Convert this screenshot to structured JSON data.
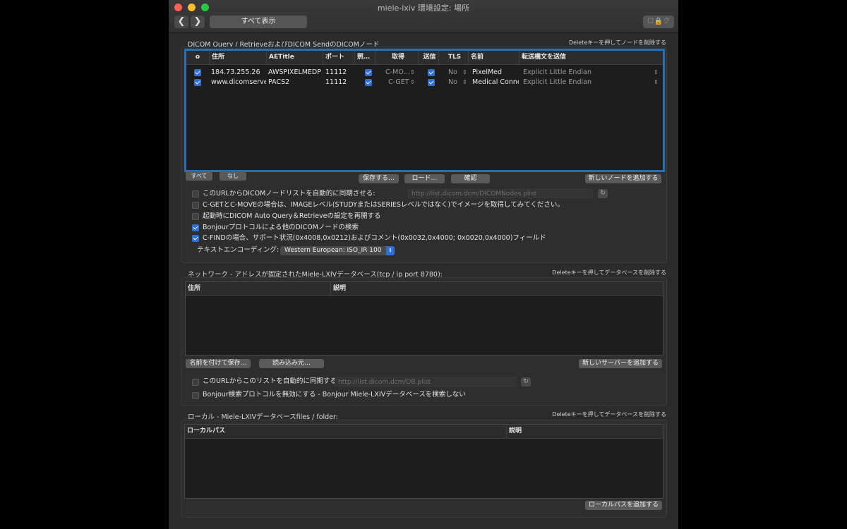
{
  "window": {
    "title": "miele-lxiv 環境設定: 場所"
  },
  "toolbar": {
    "back": "❮",
    "forward": "❯",
    "show_all": "すべて表示",
    "lock": "ロ🔒ク"
  },
  "dicom": {
    "title": "DICOM Query / RetrieveおよびDICOM SendのDICOMノード",
    "hint": "Deleteキーを押してノードを削除する",
    "headers": [
      "o",
      "住所",
      "AETitle",
      "ポート",
      "照…",
      "取得",
      "送信",
      "TLS",
      "名前",
      "転送構文を送信"
    ],
    "rows": [
      {
        "address": "184.73.255.26",
        "aetitle": "AWSPIXELMEDP",
        "port": "11112",
        "retrieve": "C-MO…",
        "tls": "No",
        "name": "PixelMed",
        "syntax": "Explicit Little Endian"
      },
      {
        "address": "www.dicomserve",
        "aetitle": "PACS2",
        "port": "11112",
        "retrieve": "C-GET",
        "tls": "No",
        "name": "Medical Conne",
        "syntax": "Explicit Little Endian"
      }
    ],
    "btn_all": "すべて",
    "btn_none": "なし",
    "btn_save": "保存する…",
    "btn_load": "ロード…",
    "btn_verify": "確認",
    "btn_add_node": "新しいノードを追加する",
    "opt_sync_url": "このURLからDICOMノードリストを自動的に同期させる:",
    "sync_url_value": "http://list.dicom.dcm/DICOMNodes.plist",
    "opt_image_level": "C-GETとC-MOVEの場合は、IMAGEレベル(STUDYまたはSERIESレベルではなく)でイメージを取得してみてください。",
    "opt_autoquery": "起動時にDICOM Auto Query＆Retrieveの設定を再開する",
    "opt_bonjour": "Bonjourプロトコルによる他のDICOMノードの検索",
    "opt_cfind": "C-FINDの場合、サポート状況(0x4008,0x0212)およびコメント(0x0032,0x4000; 0x0020,0x4000)フィールド",
    "encoding_label": "テキストエンコーディング:",
    "encoding_value": "Western European: ISO_IR 100"
  },
  "network": {
    "title": "ネットワーク - アドレスが固定されたMiele-LXIVデータベース(tcp / ip port 8780):",
    "hint": "Deleteキーを押してデータベースを削除する",
    "headers": [
      "住所",
      "説明"
    ],
    "btn_save_as": "名前を付けて保存…",
    "btn_load_from": "読み込み元…",
    "btn_add_server": "新しいサーバーを追加する",
    "opt_sync": "このURLからこのリストを自動的に同期する:",
    "sync_url_value": "http://list.dicom.dcm/DB.plist",
    "opt_bonjour_disable": "Bonjour検索プロトコルを無効にする - Bonjour Miele-LXIVデータベースを検索しない"
  },
  "local": {
    "title": "ローカル -  Miele-LXIVデータベースfiles / folder:",
    "hint": "Deleteキーを押してデータベースを削除する",
    "headers": [
      "ローカルパス",
      "説明"
    ],
    "btn_add_local": "ローカルパスを追加する"
  },
  "colors": {
    "accent": "#2f6fd6",
    "focus_ring": "#2a6fb0",
    "close": "#fe5f57",
    "minimize": "#febc2e",
    "zoom": "#28c840"
  }
}
